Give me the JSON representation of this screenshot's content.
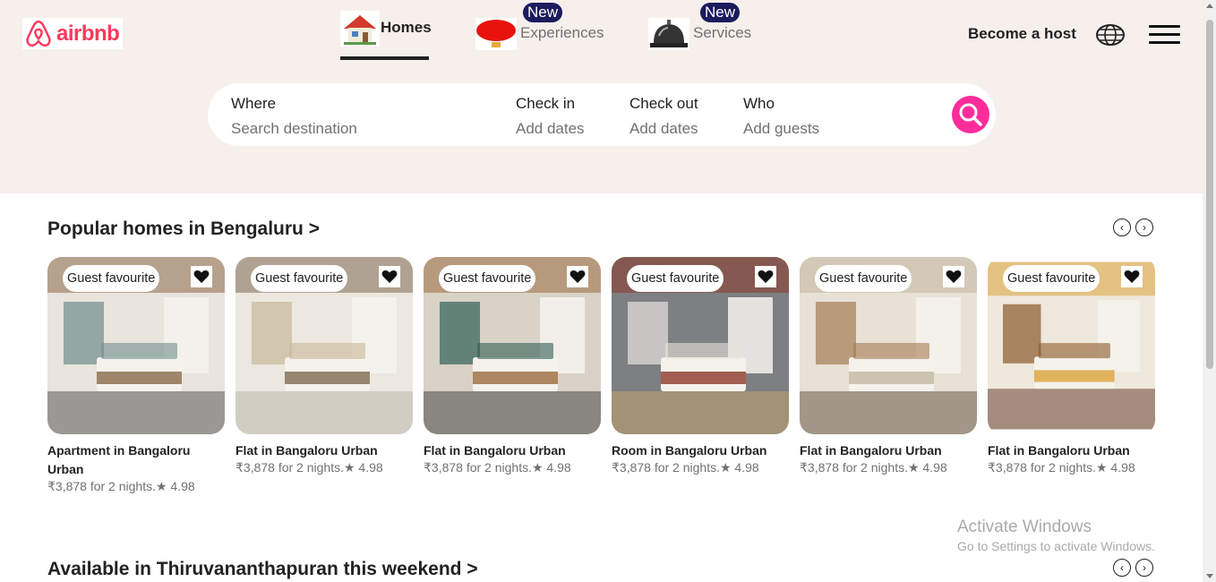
{
  "brand": {
    "name": "airbnb",
    "color": "#ff385c",
    "icon": "airbnb-logo-icon"
  },
  "nav": {
    "tabs": [
      {
        "label": "Homes",
        "icon": "house-icon",
        "active": true
      },
      {
        "label": "Experiences",
        "icon": "hot-air-balloon-icon",
        "badge": "New"
      },
      {
        "label": "Services",
        "icon": "service-bell-icon",
        "badge": "New"
      }
    ],
    "host": "Become a host",
    "globe_icon": "globe-icon",
    "menu_icon": "hamburger-menu-icon"
  },
  "search": {
    "where_label": "Where",
    "where_placeholder": "Search destination",
    "checkin_label": "Check in",
    "checkin_placeholder": "Add dates",
    "checkout_label": "Check out",
    "checkout_placeholder": "Add dates",
    "who_label": "Who",
    "who_placeholder": "Add guests",
    "button_icon": "search-icon",
    "button_color": "#ff2d9b"
  },
  "sections": [
    {
      "title": "Popular homes in Bengaluru >",
      "cards": [
        {
          "badge": "Guest favourite",
          "title": "Apartment in Bangaloru Urban",
          "meta": "₹3,878 for 2 nights.★ 4.98"
        },
        {
          "badge": "Guest favourite",
          "title": "Flat in Bangaloru Urban",
          "meta": "₹3,878 for 2 nights.★ 4.98"
        },
        {
          "badge": "Guest favourite",
          "title": "Flat in Bangaloru Urban",
          "meta": "₹3,878 for 2 nights.★ 4.98"
        },
        {
          "badge": "Guest favourite",
          "title": "Room in Bangaloru Urban",
          "meta": "₹3,878 for 2 nights.★ 4.98"
        },
        {
          "badge": "Guest favourite",
          "title": "Flat in Bangaloru Urban",
          "meta": "₹3,878 for 2 nights.★ 4.98"
        },
        {
          "badge": "Guest favourite",
          "title": "Flat in Bangaloru Urban",
          "meta": "₹3,878 for 2 nights.★ 4.98"
        }
      ]
    },
    {
      "title": "Available in Thiruvananthapuran this weekend >"
    }
  ],
  "watermark": {
    "line1": "Activate Windows",
    "line2": "Go to Settings to activate Windows."
  }
}
